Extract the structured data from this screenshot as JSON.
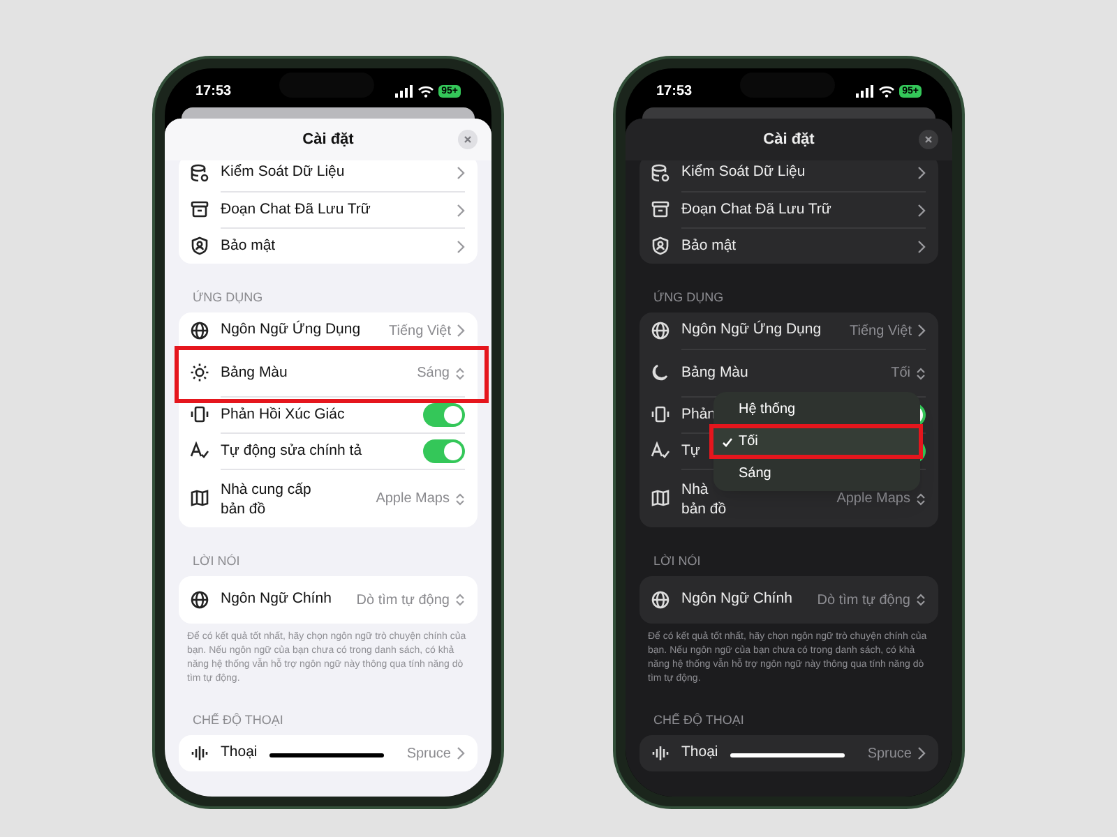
{
  "phones": [
    {
      "dark_mode": false,
      "status_bar": {
        "time": "17:53",
        "battery": "95+"
      },
      "sheet": {
        "title": "Cài đặt",
        "sections": [
          {
            "rows": [
              {
                "kind": "link",
                "label": "Kiểm Soát Dữ Liệu"
              },
              {
                "kind": "link",
                "label": "Đoạn Chat Đã Lưu Trữ"
              },
              {
                "kind": "link",
                "label": "Bảo mật"
              }
            ]
          },
          {
            "header": "ỨNG DỤNG",
            "rows": [
              {
                "kind": "link",
                "label": "Ngôn Ngữ Ứng Dụng",
                "value": "Tiếng Việt"
              },
              {
                "kind": "select",
                "label": "Bảng Màu",
                "value": "Sáng",
                "highlighted": true
              },
              {
                "kind": "toggle",
                "label": "Phản Hồi Xúc Giác",
                "on": true
              },
              {
                "kind": "toggle",
                "label": "Tự động sửa chính tả",
                "on": true
              },
              {
                "kind": "select",
                "label": "Nhà cung cấp",
                "label_2": "bản đồ",
                "value": "Apple Maps"
              }
            ]
          },
          {
            "header": "LỜI NÓI",
            "rows": [
              {
                "kind": "select",
                "label": "Ngôn Ngữ Chính",
                "value": "Dò tìm tự động"
              }
            ],
            "footer": "Để có kết quả tốt nhất, hãy chọn ngôn ngữ trò chuyện chính của bạn. Nếu ngôn ngữ của bạn chưa có trong danh sách, có khả năng hệ thống vẫn hỗ trợ ngôn ngữ này thông qua tính năng dò tìm tự động."
          },
          {
            "header": "CHẾ ĐỘ THOẠI",
            "rows": [
              {
                "kind": "link",
                "label": "Thoại",
                "value": "Spruce"
              }
            ]
          }
        ]
      }
    },
    {
      "dark_mode": true,
      "status_bar": {
        "time": "17:53",
        "battery": "95+"
      },
      "sheet": {
        "title": "Cài đặt",
        "sections": [
          {
            "rows": [
              {
                "kind": "link",
                "label": "Kiểm Soát Dữ Liệu"
              },
              {
                "kind": "link",
                "label": "Đoạn Chat Đã Lưu Trữ"
              },
              {
                "kind": "link",
                "label": "Bảo mật"
              }
            ]
          },
          {
            "header": "ỨNG DỤNG",
            "rows": [
              {
                "kind": "link",
                "label": "Ngôn Ngữ Ứng Dụng",
                "value": "Tiếng Việt"
              },
              {
                "kind": "select",
                "label": "Bảng Màu",
                "value": "Tối"
              },
              {
                "kind": "toggle",
                "label": "Phản",
                "on": true
              },
              {
                "kind": "toggle",
                "label": "Tự",
                "on": true
              },
              {
                "kind": "select",
                "label": "Nhà",
                "label_2": "bản đồ",
                "value": "Apple Maps"
              }
            ]
          },
          {
            "header": "LỜI NÓI",
            "rows": [
              {
                "kind": "select",
                "label": "Ngôn Ngữ Chính",
                "value": "Dò tìm tự động"
              }
            ],
            "footer": "Để có kết quả tốt nhất, hãy chọn ngôn ngữ trò chuyện chính của bạn. Nếu ngôn ngữ của bạn chưa có trong danh sách, có khả năng hệ thống vẫn hỗ trợ ngôn ngữ này thông qua tính năng dò tìm tự động."
          },
          {
            "header": "CHẾ ĐỘ THOẠI",
            "rows": [
              {
                "kind": "link",
                "label": "Thoại",
                "value": "Spruce"
              }
            ]
          }
        ]
      },
      "menu": {
        "items": [
          {
            "label": "Hệ thống",
            "selected": false
          },
          {
            "label": "Tối",
            "selected": true,
            "highlighted": true
          },
          {
            "label": "Sáng",
            "selected": false
          }
        ]
      }
    }
  ]
}
